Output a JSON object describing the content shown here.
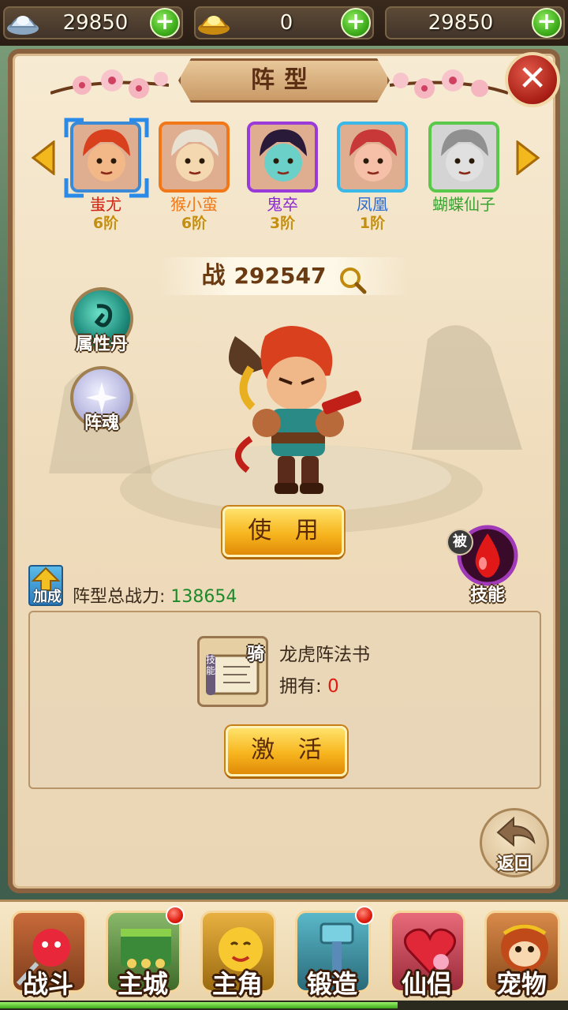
{
  "currency": {
    "silver": {
      "icon": "silver-ingot-icon",
      "value": "29850"
    },
    "gold": {
      "icon": "gold-ingot-icon",
      "value": "0"
    },
    "third": {
      "value": "29850"
    }
  },
  "panel": {
    "title": "阵型"
  },
  "heroes": [
    {
      "name": "蚩尤",
      "rank": "6阶",
      "color": "#d02010",
      "frame": "#3a8ad8",
      "selected": true
    },
    {
      "name": "猴小蛮",
      "rank": "6阶",
      "color": "#f07818",
      "frame": "#f07818",
      "selected": false
    },
    {
      "name": "鬼卒",
      "rank": "3阶",
      "color": "#8a2ad0",
      "frame": "#9a3ad8",
      "selected": false
    },
    {
      "name": "凤凰",
      "rank": "1阶",
      "color": "#2a6ad0",
      "frame": "#3ab8e8",
      "selected": false
    },
    {
      "name": "蝴蝶仙子",
      "rank": "",
      "color": "#3aa030",
      "frame": "#5ac84a",
      "selected": false
    }
  ],
  "power": {
    "label": "战",
    "value": "292547"
  },
  "side_buttons": {
    "pill": "属性丹",
    "soul": "阵魂"
  },
  "use_button": "使 用",
  "skill": {
    "badge": "被",
    "label": "技能"
  },
  "bonus": {
    "icon_label": "加成",
    "text": "阵型总战力:",
    "value": "138654"
  },
  "item": {
    "name": "龙虎阵法书",
    "own_label": "拥有:",
    "own_count": "0",
    "badge": "骑",
    "scroll_text": "技能"
  },
  "activate_button": "激 活",
  "back_label": "返回",
  "nav": [
    {
      "label": "战斗",
      "dot": false
    },
    {
      "label": "主城",
      "dot": true
    },
    {
      "label": "主角",
      "dot": false
    },
    {
      "label": "锻造",
      "dot": true
    },
    {
      "label": "仙侣",
      "dot": false
    },
    {
      "label": "宠物",
      "dot": false
    }
  ],
  "xp_fraction": 0.7
}
